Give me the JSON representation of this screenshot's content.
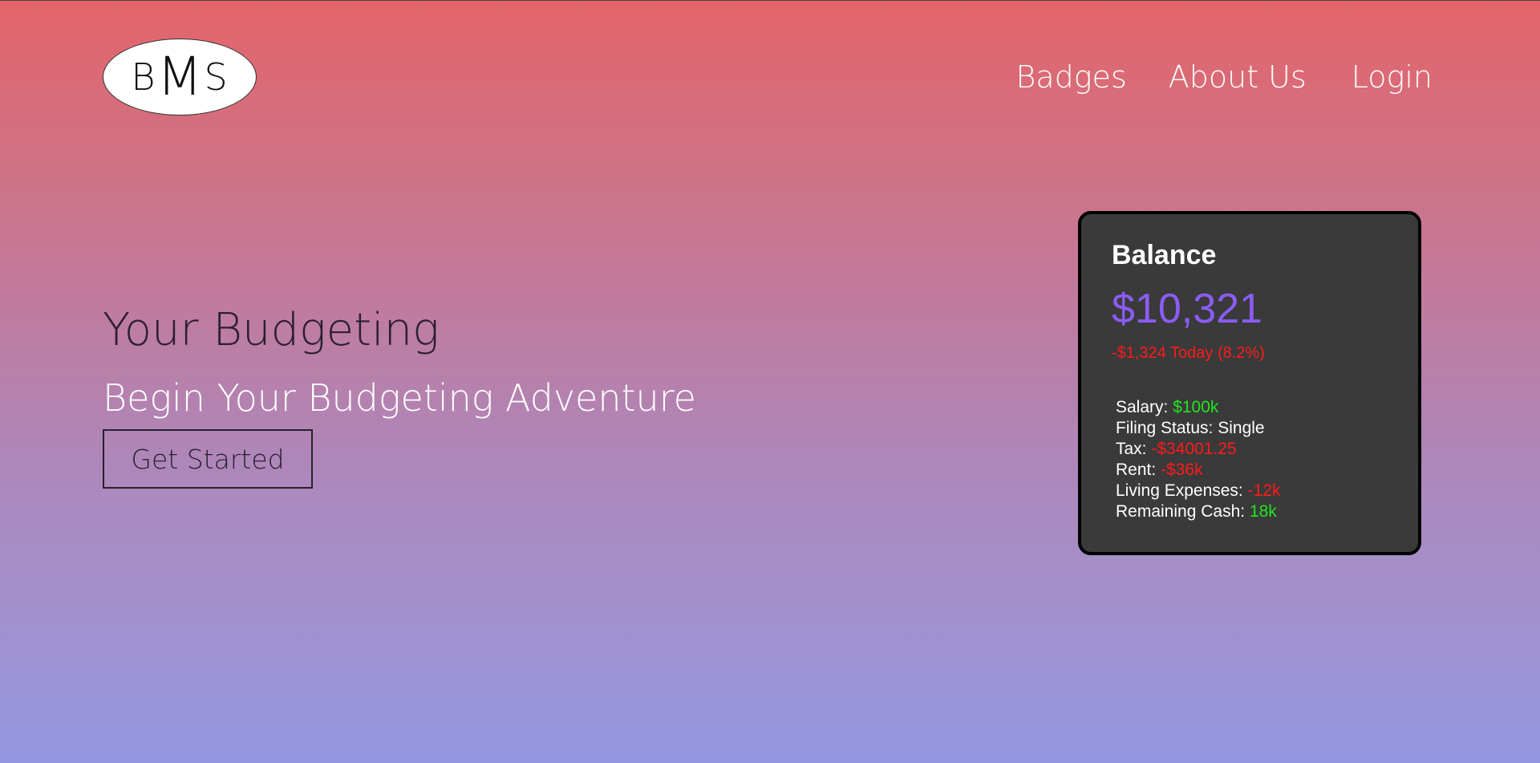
{
  "logo": {
    "letters": [
      "B",
      "M",
      "S"
    ]
  },
  "nav": {
    "items": [
      {
        "label": "Badges"
      },
      {
        "label": "About Us"
      },
      {
        "label": "Login"
      }
    ]
  },
  "hero": {
    "title": "Your Budgeting",
    "subtitle": "Begin Your Budgeting Adventure",
    "cta_label": "Get Started"
  },
  "balance_card": {
    "title": "Balance",
    "amount": "$10,321",
    "change": "-$1,324 Today (8.2%)",
    "details": [
      {
        "label": "Salary:",
        "value": "$100k",
        "tone": "positive"
      },
      {
        "label": "Filing Status:",
        "value": "Single",
        "tone": "neutral"
      },
      {
        "label": "Tax:",
        "value": "-$34001.25",
        "tone": "negative"
      },
      {
        "label": "Rent:",
        "value": "-$36k",
        "tone": "negative"
      },
      {
        "label": "Living Expenses:",
        "value": "-12k",
        "tone": "negative"
      },
      {
        "label": "Remaining Cash:",
        "value": "18k",
        "tone": "positive"
      }
    ]
  },
  "colors": {
    "gradient_top": "#e5646a",
    "gradient_bottom": "#9497e0",
    "card_bg": "#3a3a3a",
    "amount_purple": "#8b5cf6",
    "positive_green": "#22e61f",
    "negative_red": "#ff1a1a"
  }
}
